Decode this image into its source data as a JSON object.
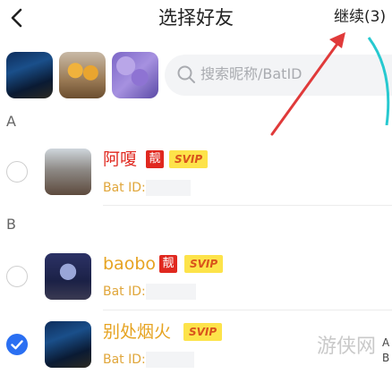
{
  "header": {
    "back_icon": "chevron-left-icon",
    "title": "选择好友",
    "continue_label": "继续(3)"
  },
  "selected_friends": [
    {
      "name": "selected-avatar-1"
    },
    {
      "name": "selected-avatar-2"
    },
    {
      "name": "selected-avatar-3"
    }
  ],
  "search": {
    "icon": "search-icon",
    "placeholder": "搜索昵称/BatID"
  },
  "sections": [
    {
      "letter": "A",
      "friends": [
        {
          "nickname": "阿嗄",
          "badge_liang": "靓",
          "badge_svip": "SVIP",
          "bat_id_label": "Bat ID:",
          "checked": false
        }
      ]
    },
    {
      "letter": "B",
      "friends": [
        {
          "nickname": "baobo",
          "badge_liang": "靓",
          "badge_svip": "SVIP",
          "bat_id_label": "Bat ID:",
          "checked": false
        },
        {
          "nickname": "别处烟火",
          "badge_svip": "SVIP",
          "bat_id_label": "Bat ID:",
          "checked": true
        }
      ]
    }
  ],
  "index_bar": [
    "A",
    "B"
  ],
  "watermark": "游侠网",
  "colors": {
    "nickname_red": "#e0281f",
    "nickname_gold": "#e6a321",
    "checked_blue": "#2a6ff2",
    "svip_yellow": "#fde34a",
    "annotation_arrow": "#e03a3a"
  }
}
